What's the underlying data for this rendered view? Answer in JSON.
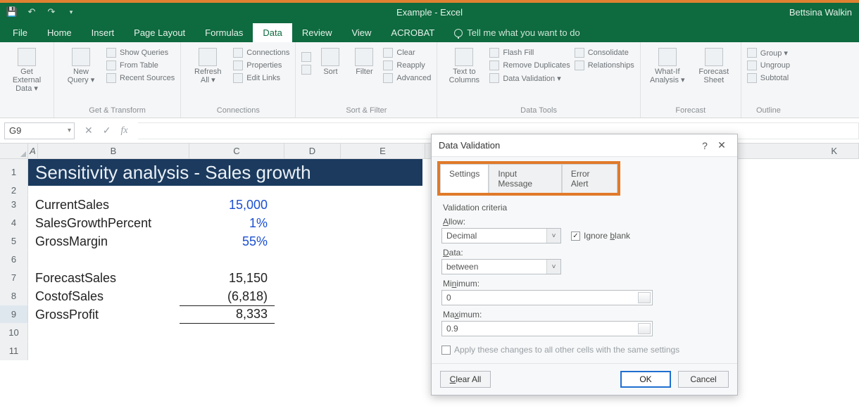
{
  "titlebar": {
    "doc_title": "Example - Excel",
    "user": "Bettsina Walkin"
  },
  "tabs": {
    "file": "File",
    "home": "Home",
    "insert": "Insert",
    "page_layout": "Page Layout",
    "formulas": "Formulas",
    "data": "Data",
    "review": "Review",
    "view": "View",
    "acrobat": "ACROBAT",
    "tellme": "Tell me what you want to do"
  },
  "ribbon": {
    "get_external": "Get External\nData ▾",
    "new_query": "New\nQuery ▾",
    "show_queries": "Show Queries",
    "from_table": "From Table",
    "recent_sources": "Recent Sources",
    "group_get_transform": "Get & Transform",
    "refresh_all": "Refresh\nAll ▾",
    "connections": "Connections",
    "properties": "Properties",
    "edit_links": "Edit Links",
    "group_connections": "Connections",
    "sort": "Sort",
    "filter": "Filter",
    "clear": "Clear",
    "reapply": "Reapply",
    "advanced": "Advanced",
    "group_sort_filter": "Sort & Filter",
    "text_to_cols": "Text to\nColumns",
    "flash_fill": "Flash Fill",
    "remove_dup": "Remove Duplicates",
    "data_validation": "Data Validation  ▾",
    "consolidate": "Consolidate",
    "relationships": "Relationships",
    "group_data_tools": "Data Tools",
    "whatif": "What-If\nAnalysis ▾",
    "forecast_sheet": "Forecast\nSheet",
    "group_forecast": "Forecast",
    "grp_group": "Group  ▾",
    "grp_ungroup": "Ungroup",
    "grp_subtotal": "Subtotal",
    "group_outline": "Outline"
  },
  "formula_bar": {
    "namebox": "G9",
    "fx": "fx"
  },
  "columns": [
    "A",
    "B",
    "C",
    "D",
    "E",
    "",
    "",
    "",
    "",
    "",
    "K"
  ],
  "rows": [
    "1",
    "2",
    "3",
    "4",
    "5",
    "6",
    "7",
    "8",
    "9",
    "10",
    "11"
  ],
  "sheet": {
    "title": "Sensitivity analysis - Sales growth",
    "labels": {
      "current_sales": "CurrentSales",
      "sales_growth_pct": "SalesGrowthPercent",
      "gross_margin": "GrossMargin",
      "forecast_sales": "ForecastSales",
      "cost_of_sales": "CostofSales",
      "gross_profit": "GrossProfit"
    },
    "values": {
      "current_sales": "15,000",
      "sales_growth_pct": "1%",
      "gross_margin": "55%",
      "forecast_sales": "15,150",
      "cost_of_sales": "(6,818)",
      "gross_profit": "8,333"
    }
  },
  "dialog": {
    "title": "Data Validation",
    "tabs": {
      "settings": "Settings",
      "input_msg": "Input Message",
      "error_alert": "Error Alert"
    },
    "criteria_label": "Validation criteria",
    "allow_label": "Allow:",
    "allow_value": "Decimal",
    "ignore_blank": "Ignore blank",
    "data_label": "Data:",
    "data_value": "between",
    "min_label": "Minimum:",
    "min_value": "0",
    "max_label": "Maximum:",
    "max_value": "0.9",
    "apply_all": "Apply these changes to all other cells with the same settings",
    "clear_all": "Clear All",
    "ok": "OK",
    "cancel": "Cancel"
  }
}
